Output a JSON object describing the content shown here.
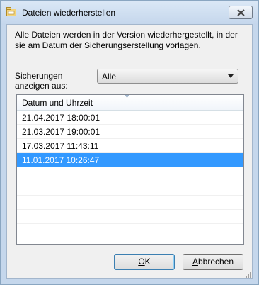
{
  "window": {
    "title": "Dateien wiederherstellen",
    "colors": {
      "frame": "#c5d7ec",
      "selection": "#3399ff"
    }
  },
  "description": "Alle Dateien werden in der Version wiederhergestellt, in der sie am Datum der Sicherungserstellung vorlagen.",
  "filter": {
    "label": "Sicherungen anzeigen aus:",
    "selected": "Alle"
  },
  "list": {
    "column_header": "Datum und Uhrzeit",
    "rows": [
      {
        "value": "21.04.2017 18:00:01",
        "selected": false
      },
      {
        "value": "21.03.2017 19:00:01",
        "selected": false
      },
      {
        "value": "17.03.2017 11:43:11",
        "selected": false
      },
      {
        "value": "11.01.2017 10:26:47",
        "selected": true
      }
    ]
  },
  "buttons": {
    "ok_access": "O",
    "ok_rest": "K",
    "cancel_access": "A",
    "cancel_rest": "bbrechen"
  }
}
